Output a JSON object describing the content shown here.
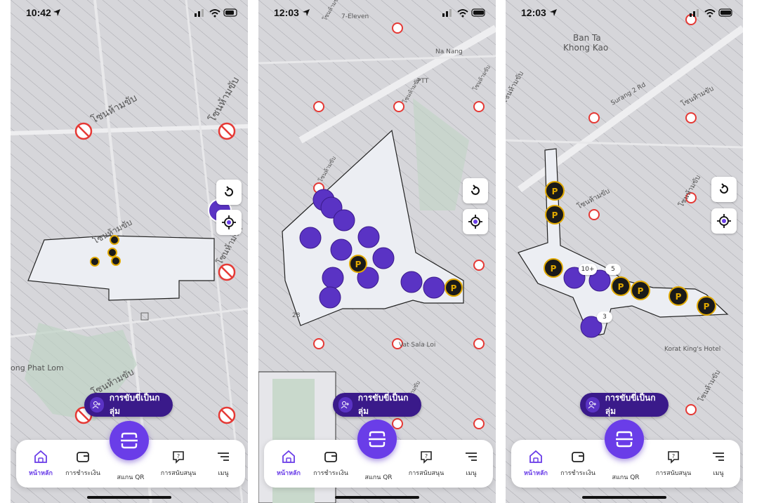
{
  "screens": [
    {
      "time": "10:42",
      "zone_labels": [
        "โซนห้ามขับ",
        "โซนห้ามขับ",
        "โซนห้ามขับ",
        "โซนห้ามขับ",
        "โซนห้ามขับ"
      ],
      "place_labels": [
        "ong Phat Lom"
      ],
      "badges": []
    },
    {
      "time": "12:03",
      "zone_labels": [
        "โซนห้ามขับ",
        "โซนห้ามขับ",
        "โซนห้ามขับ",
        "โซนห้ามขับ",
        "โซนห้ามขับ"
      ],
      "place_labels": [
        "7-Eleven",
        "Na Nang",
        "PTT",
        "Vat Sala Loi",
        "28"
      ],
      "badges": []
    },
    {
      "time": "12:03",
      "zone_labels": [
        "โซนห้ามขับ",
        "โซนห้ามขับ",
        "โซนห้ามขับ",
        "โซนห้ามขับ",
        "โซนห้ามขับ"
      ],
      "place_labels": [
        "Ban Ta",
        "Khong Kao",
        "Korat King's Hotel",
        "Surang 2 Rd"
      ],
      "badges": [
        "10+",
        "5",
        "3"
      ]
    }
  ],
  "group_ride_label": "การขับขี่เป็นกลุ่ม",
  "nav": {
    "home": "หน้าหลัก",
    "payment": "การชำระเงิน",
    "scan": "สแกน QR",
    "support": "การสนับสนุน",
    "menu": "เมนู"
  },
  "colors": {
    "brand": "#6a3de8",
    "brand_dark": "#3a1a8a",
    "parking": "#1a1a1a",
    "parking_ring": "#e0a800",
    "no_ride": "#e53935"
  },
  "icons": [
    "home-icon",
    "wallet-icon",
    "scan-icon",
    "support-icon",
    "menu-icon",
    "refresh-icon",
    "locate-icon",
    "scooter-icon",
    "parking-icon",
    "no-scooter-icon",
    "group-icon",
    "location-arrow-icon"
  ]
}
